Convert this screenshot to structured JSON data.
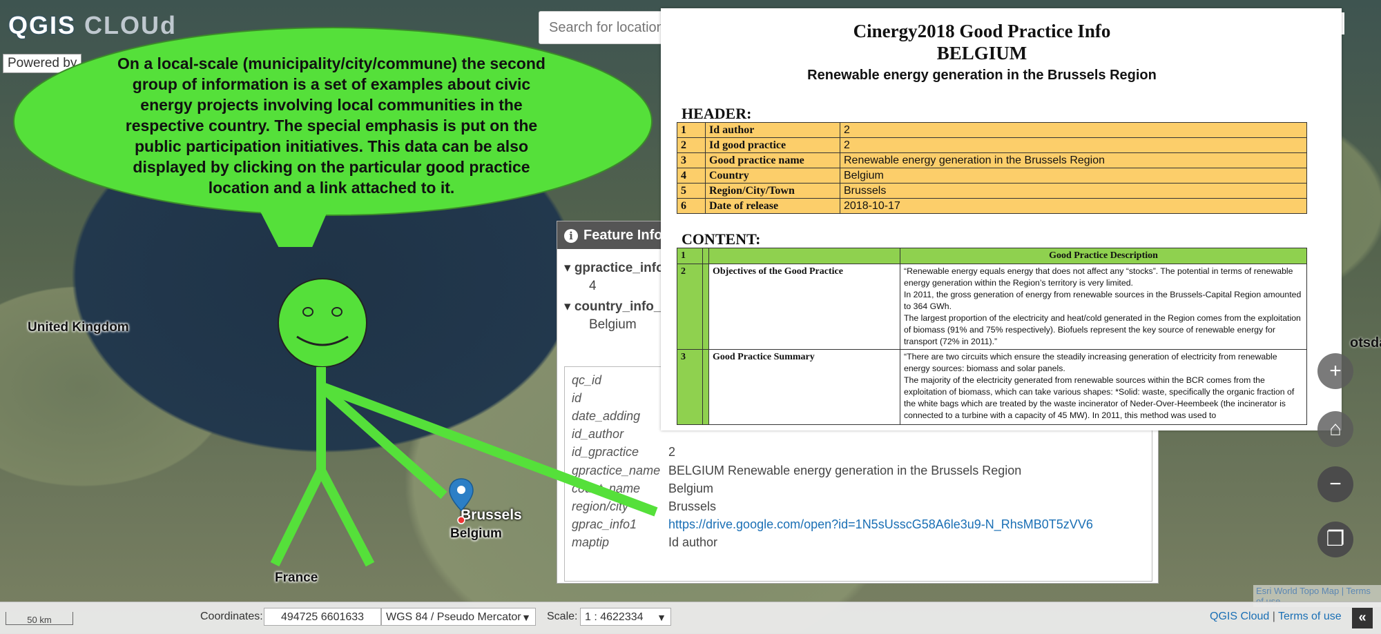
{
  "app": {
    "logo": {
      "q": "QGIS",
      "cloud": "CLOUd"
    },
    "powered_by": "Powered by",
    "search_placeholder": "Search for location"
  },
  "bubble": {
    "text": "On a local-scale (municipality/city/commune) the second group of information is a set of examples about civic energy projects involving local communities in the respective country. The special emphasis is put on the public participation initiatives. This data can be also displayed by clicking on the particular good practice location and a link attached to it."
  },
  "map_labels": {
    "united_kingdom": "United Kingdom",
    "france": "France",
    "brussels": "Brussels",
    "belgium": "Belgium",
    "potsdam_partial": "otsda"
  },
  "feature_info": {
    "title": "Feature Info",
    "tree": [
      {
        "label": "gpractice_info",
        "value": "4"
      },
      {
        "label": "country_info_",
        "value": "Belgium"
      }
    ],
    "attributes": [
      {
        "key": "qc_id",
        "value": ""
      },
      {
        "key": "id",
        "value": ""
      },
      {
        "key": "date_adding",
        "value": ""
      },
      {
        "key": "id_author",
        "value": ""
      },
      {
        "key": "id_gpractice",
        "value": "2"
      },
      {
        "key": "gpractice_name",
        "value": "BELGIUM Renewable energy generation in the Brussels Region"
      },
      {
        "key": "count_name",
        "value": "Belgium"
      },
      {
        "key": "region/city",
        "value": "Brussels"
      },
      {
        "key": "gprac_info1",
        "value": "https://drive.google.com/open?id=1N5sUsscG58A6le3u9-N_RhsMB0T5zVV6",
        "link": true
      },
      {
        "key": "maptip",
        "value": "Id author"
      }
    ]
  },
  "document": {
    "title1": "Cinergy2018 Good Practice Info",
    "title2": "BELGIUM",
    "title3": "Renewable energy generation in the Brussels Region",
    "header_label": "HEADER:",
    "header_rows": [
      {
        "n": "1",
        "k": "Id author",
        "v": "2"
      },
      {
        "n": "2",
        "k": "Id good practice",
        "v": "2"
      },
      {
        "n": "3",
        "k": "Good practice name",
        "v": "Renewable energy generation in the Brussels Region"
      },
      {
        "n": "4",
        "k": "Country",
        "v": "Belgium"
      },
      {
        "n": "5",
        "k": "Region/City/Town",
        "v": "Brussels"
      },
      {
        "n": "6",
        "k": "Date of release",
        "v": "2018-10-17"
      }
    ],
    "content_label": "CONTENT:",
    "content_head": {
      "n": "1",
      "col": "Good Practice Description"
    },
    "content_rows": [
      {
        "n": "2",
        "k": "Objectives of the Good Practice",
        "v": "“Renewable energy equals energy that does not affect any “stocks”. The potential in terms of renewable energy generation within the Region’s territory is very limited.\nIn 2011, the gross generation of energy from renewable sources in the Brussels-Capital Region amounted to 364 GWh.\nThe largest proportion of the electricity and heat/cold generated in the Region comes from the exploitation of biomass (91% and 75% respectively). Biofuels represent the key source of renewable energy for transport (72% in 2011).”"
      },
      {
        "n": "3",
        "k": "Good Practice Summary",
        "v": "“There are two circuits which ensure the steadily increasing generation of electricity from renewable energy sources: biomass and solar panels.\nThe majority of the electricity generated from renewable sources within the BCR comes from the exploitation of biomass, which can take various shapes:  *Solid: waste, specifically the organic fraction of the white bags which are treated by the waste incinerator of Neder-Over-Heembeek (the incinerator is connected to a turbine with a capacity of 45 MW). In 2011, this method was used to"
      }
    ]
  },
  "zoom": {
    "minus": "−",
    "layers": "❐"
  },
  "bottom_bar": {
    "scale_bar": "50 km",
    "coordinates_label": "Coordinates:",
    "coordinates_value": "494725 6601633",
    "crs": "WGS 84 / Pseudo Mercator",
    "scale_label": "Scale:",
    "scale_value": "1 : 4622334",
    "link_qgis": "QGIS Cloud",
    "sep": " | ",
    "link_terms": "Terms of use",
    "collapse": "«"
  },
  "attribution_small": "Esri World Topo Map | Terms of use",
  "colors": {
    "bubble_green": "#55e03a",
    "header_orange": "#fcce6a",
    "content_green": "#8fd14f",
    "link_blue": "#1a6fb5"
  }
}
